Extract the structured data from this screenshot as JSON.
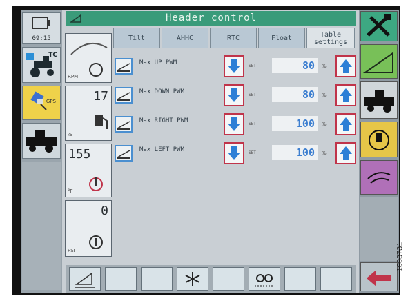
{
  "header": {
    "title": "Header control"
  },
  "clock": {
    "time": "09:15"
  },
  "tabs": [
    {
      "label": "Tilt"
    },
    {
      "label": "AHHC"
    },
    {
      "label": "RTC"
    },
    {
      "label": "Float"
    },
    {
      "label_line1": "Table",
      "label_line2": "settings"
    }
  ],
  "gauges": [
    {
      "name": "rpm",
      "value": "",
      "unit": "RPM"
    },
    {
      "name": "fuel",
      "value": "17",
      "unit": "%"
    },
    {
      "name": "temperature",
      "value": "155",
      "unit": "°F"
    },
    {
      "name": "pressure",
      "value": "0",
      "unit": "PSI"
    }
  ],
  "rows": [
    {
      "label": "Max UP PWM",
      "set": "SET",
      "value": "80",
      "unit": "%"
    },
    {
      "label": "Max DOWN PWM",
      "set": "SET",
      "value": "80",
      "unit": "%"
    },
    {
      "label": "Max RIGHT PWM",
      "set": "SET",
      "value": "100",
      "unit": "%"
    },
    {
      "label": "Max LEFT PWM",
      "set": "SET",
      "value": "100",
      "unit": "%"
    }
  ],
  "left_panel": {
    "gps_label": "GPS",
    "tc_label": "TC"
  },
  "figure_id": "1003731",
  "colors": {
    "title_bar": "#3a9b7a",
    "value_text": "#3d7fd0",
    "arrow_blue": "#2d7fd6",
    "button_border": "#c0344a"
  }
}
